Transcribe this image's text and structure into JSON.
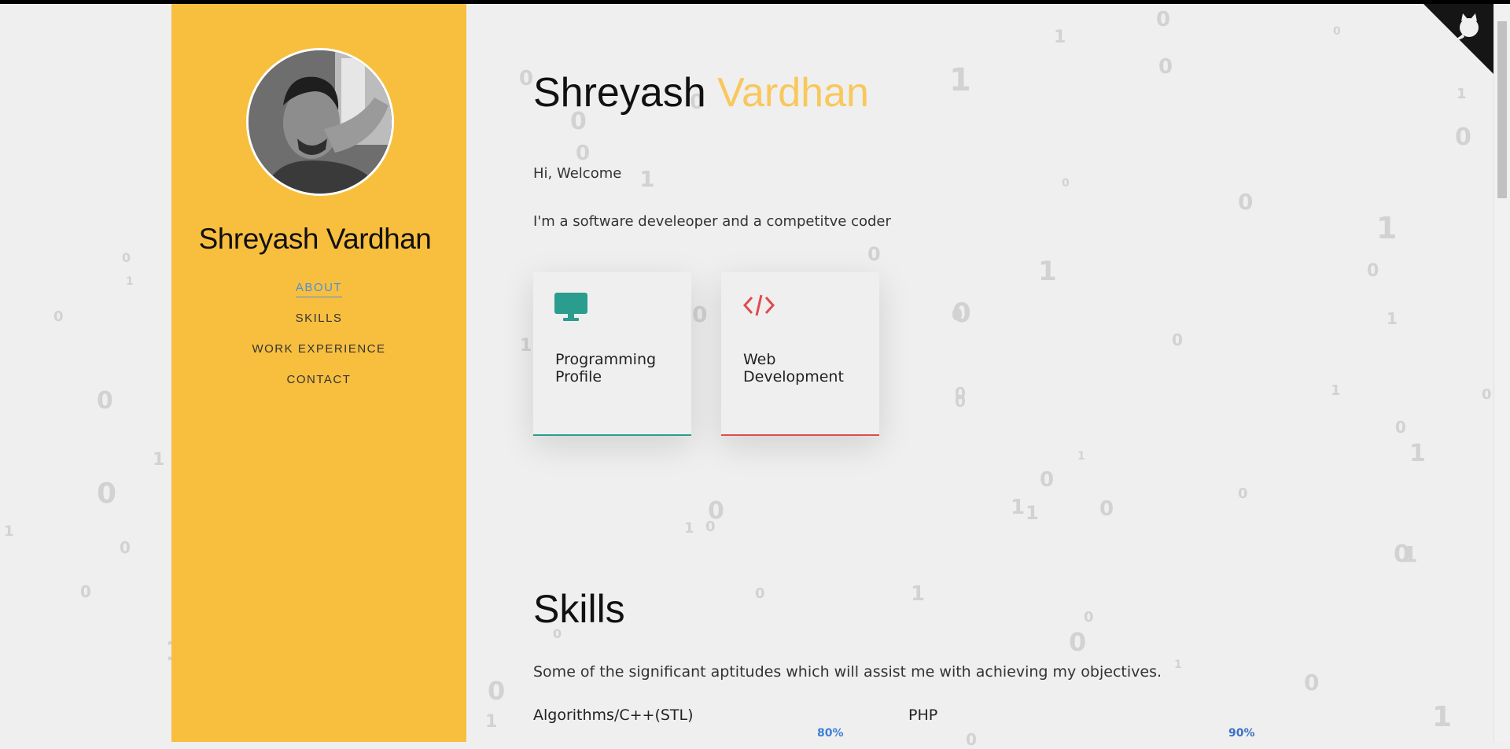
{
  "sidebar": {
    "name": "Shreyash Vardhan",
    "nav": [
      {
        "label": "ABOUT",
        "active": true
      },
      {
        "label": "SKILLS",
        "active": false
      },
      {
        "label": "WORK EXPERIENCE",
        "active": false
      },
      {
        "label": "CONTACT",
        "active": false
      }
    ]
  },
  "hero": {
    "first_name": "Shreyash",
    "last_name": "Vardhan",
    "greeting": "Hi, Welcome",
    "intro": "I'm a software develeoper and a competitve coder"
  },
  "cards": [
    {
      "title": "Programming Profile",
      "icon": "monitor-icon",
      "color": "#2a9d8f"
    },
    {
      "title": "Web Development",
      "icon": "code-icon",
      "color": "#e04b4b"
    }
  ],
  "skills": {
    "heading": "Skills",
    "description": "Some of the significant aptitudes which will assist me with achieving my objectives.",
    "items": [
      {
        "name": "Algorithms/C++(STL)",
        "percent": "80%"
      },
      {
        "name": "PHP",
        "percent": "90%"
      }
    ]
  },
  "theme": {
    "sidebar_bg": "#f8bf3f",
    "accent_name": "#f8c85c",
    "nav_active": "#4a90d9"
  },
  "background_digits": [
    "0",
    "1",
    "0",
    "0",
    "1",
    "0",
    "1",
    "0",
    "0",
    "1",
    "0",
    "0",
    "1",
    "0",
    "1",
    "0",
    "0",
    "1",
    "0",
    "1",
    "0",
    "0",
    "1",
    "1",
    "0",
    "1",
    "0",
    "0",
    "1",
    "0",
    "1",
    "0",
    "0",
    "1",
    "0",
    "1",
    "0",
    "0",
    "1",
    "0",
    "1",
    "0",
    "0",
    "1",
    "1",
    "0",
    "0",
    "1",
    "0",
    "1",
    "0",
    "0",
    "1",
    "0",
    "0",
    "1",
    "0",
    "1",
    "0",
    "0",
    "1",
    "0",
    "1",
    "0",
    "0"
  ],
  "icons": {
    "github": "github-octocat-icon"
  }
}
